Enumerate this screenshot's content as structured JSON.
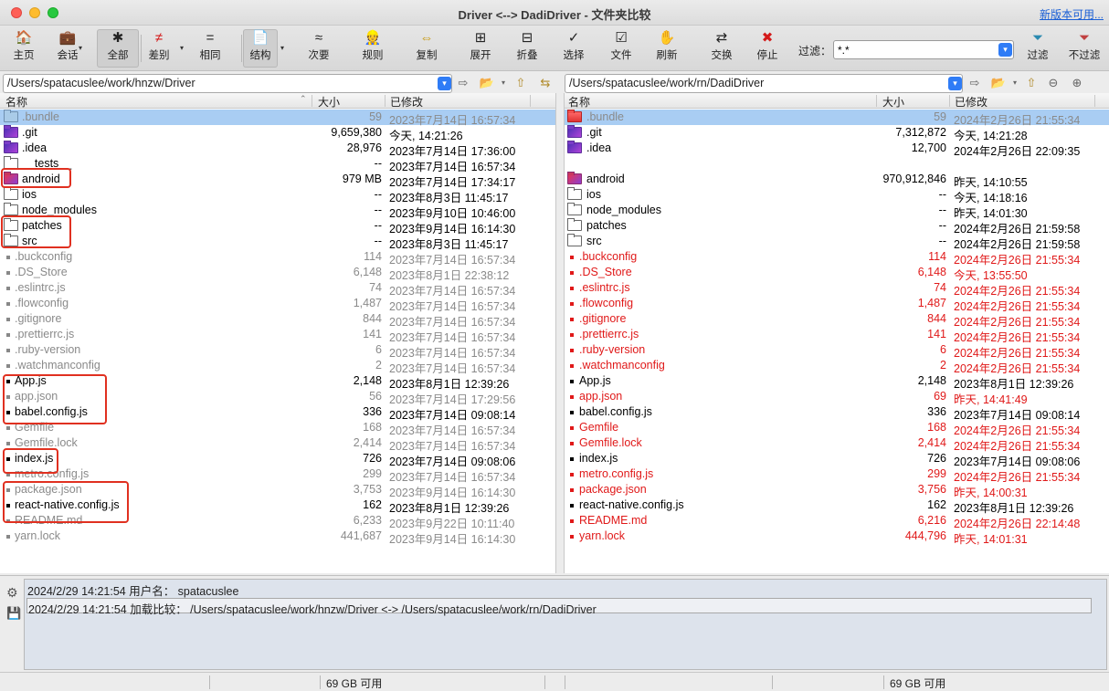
{
  "window": {
    "title": "Driver <--> DadiDriver - 文件夹比较",
    "new_version_link": "新版本可用..."
  },
  "toolbar": [
    {
      "name": "home",
      "label": "主页",
      "icon": "🏠"
    },
    {
      "name": "session",
      "label": "会话",
      "icon": "💼"
    },
    {
      "name": "all",
      "label": "全部",
      "icon": "✱"
    },
    {
      "name": "diff",
      "label": "差别",
      "icon": "≠"
    },
    {
      "name": "same",
      "label": "相同",
      "icon": "="
    },
    {
      "name": "structure",
      "label": "结构",
      "icon": "📄"
    },
    {
      "name": "minor",
      "label": "次要",
      "icon": "≈"
    },
    {
      "name": "rules",
      "label": "规则",
      "icon": "👷"
    },
    {
      "name": "copy",
      "label": "复制",
      "icon": "⇔"
    },
    {
      "name": "expand",
      "label": "展开",
      "icon": "⊞"
    },
    {
      "name": "collapse",
      "label": "折叠",
      "icon": "⊟"
    },
    {
      "name": "select",
      "label": "选择",
      "icon": "✓"
    },
    {
      "name": "files",
      "label": "文件",
      "icon": "☑"
    },
    {
      "name": "refresh",
      "label": "刷新",
      "icon": "✋"
    },
    {
      "name": "swap",
      "label": "交换",
      "icon": "⇄"
    },
    {
      "name": "stop",
      "label": "停止",
      "icon": "✖"
    },
    {
      "name": "filters",
      "label": "过滤",
      "icon": "⏷"
    },
    {
      "name": "nofilter",
      "label": "不过滤",
      "icon": "⏷"
    }
  ],
  "filter": {
    "label": "过滤：",
    "value": "*.*"
  },
  "left": {
    "path": "/Users/spatacuslee/work/hnzw/Driver",
    "headers": {
      "name": "名称",
      "size": "大小",
      "modified": "已修改"
    },
    "rows": [
      {
        "type": "folder",
        "style": "blue",
        "name": ".bundle",
        "size": "59",
        "date": "2023年7月14日 16:57:34",
        "color": "gray",
        "sel": true
      },
      {
        "type": "folder",
        "style": "pur",
        "name": ".git",
        "size": "9,659,380",
        "date": "今天, 14:21:26",
        "color": "black"
      },
      {
        "type": "folder",
        "style": "pur",
        "name": ".idea",
        "size": "28,976",
        "date": "2023年7月14日 17:36:00",
        "color": "black"
      },
      {
        "type": "folder",
        "style": "plain",
        "name": "__tests__",
        "size": "--",
        "date": "2023年7月14日 16:57:34",
        "color": "black"
      },
      {
        "type": "folder",
        "style": "redpur",
        "name": "android",
        "size": "979 MB",
        "date": "2023年7月14日 17:34:17",
        "color": "black"
      },
      {
        "type": "folder",
        "style": "plain",
        "name": "ios",
        "size": "--",
        "date": "2023年8月3日 11:45:17",
        "color": "black"
      },
      {
        "type": "folder",
        "style": "plain",
        "name": "node_modules",
        "size": "--",
        "date": "2023年9月10日 10:46:00",
        "color": "black"
      },
      {
        "type": "folder",
        "style": "plain",
        "name": "patches",
        "size": "--",
        "date": "2023年9月14日 16:14:30",
        "color": "black"
      },
      {
        "type": "folder",
        "style": "plain",
        "name": "src",
        "size": "--",
        "date": "2023年8月3日 11:45:17",
        "color": "black"
      },
      {
        "type": "file",
        "name": ".buckconfig",
        "size": "114",
        "date": "2023年7月14日 16:57:34",
        "color": "gray"
      },
      {
        "type": "file",
        "name": ".DS_Store",
        "size": "6,148",
        "date": "2023年8月1日 22:38:12",
        "color": "gray"
      },
      {
        "type": "file",
        "name": ".eslintrc.js",
        "size": "74",
        "date": "2023年7月14日 16:57:34",
        "color": "gray"
      },
      {
        "type": "file",
        "name": ".flowconfig",
        "size": "1,487",
        "date": "2023年7月14日 16:57:34",
        "color": "gray"
      },
      {
        "type": "file",
        "name": ".gitignore",
        "size": "844",
        "date": "2023年7月14日 16:57:34",
        "color": "gray"
      },
      {
        "type": "file",
        "name": ".prettierrc.js",
        "size": "141",
        "date": "2023年7月14日 16:57:34",
        "color": "gray"
      },
      {
        "type": "file",
        "name": ".ruby-version",
        "size": "6",
        "date": "2023年7月14日 16:57:34",
        "color": "gray"
      },
      {
        "type": "file",
        "name": ".watchmanconfig",
        "size": "2",
        "date": "2023年7月14日 16:57:34",
        "color": "gray"
      },
      {
        "type": "file",
        "name": "App.js",
        "size": "2,148",
        "date": "2023年8月1日 12:39:26",
        "color": "black"
      },
      {
        "type": "file",
        "name": "app.json",
        "size": "56",
        "date": "2023年7月14日 17:29:56",
        "color": "gray"
      },
      {
        "type": "file",
        "name": "babel.config.js",
        "size": "336",
        "date": "2023年7月14日 09:08:14",
        "color": "black"
      },
      {
        "type": "file",
        "name": "Gemfile",
        "size": "168",
        "date": "2023年7月14日 16:57:34",
        "color": "gray"
      },
      {
        "type": "file",
        "name": "Gemfile.lock",
        "size": "2,414",
        "date": "2023年7月14日 16:57:34",
        "color": "gray"
      },
      {
        "type": "file",
        "name": "index.js",
        "size": "726",
        "date": "2023年7月14日 09:08:06",
        "color": "black"
      },
      {
        "type": "file",
        "name": "metro.config.js",
        "size": "299",
        "date": "2023年7月14日 16:57:34",
        "color": "gray"
      },
      {
        "type": "file",
        "name": "package.json",
        "size": "3,753",
        "date": "2023年9月14日 16:14:30",
        "color": "gray"
      },
      {
        "type": "file",
        "name": "react-native.config.js",
        "size": "162",
        "date": "2023年8月1日 12:39:26",
        "color": "black"
      },
      {
        "type": "file",
        "name": "README.md",
        "size": "6,233",
        "date": "2023年9月22日 10:11:40",
        "color": "gray"
      },
      {
        "type": "file",
        "name": "yarn.lock",
        "size": "441,687",
        "date": "2023年9月14日 16:14:30",
        "color": "gray"
      }
    ]
  },
  "right": {
    "path": "/Users/spatacuslee/work/rn/DadiDriver",
    "headers": {
      "name": "名称",
      "size": "大小",
      "modified": "已修改"
    },
    "rows": [
      {
        "type": "folder",
        "style": "red",
        "name": ".bundle",
        "size": "59",
        "date": "2024年2月26日 21:55:34",
        "color": "gray",
        "sel": true
      },
      {
        "type": "folder",
        "style": "pur",
        "name": ".git",
        "size": "7,312,872",
        "date": "今天, 14:21:28",
        "color": "black"
      },
      {
        "type": "folder",
        "style": "pur",
        "name": ".idea",
        "size": "12,700",
        "date": "2024年2月26日 22:09:35",
        "color": "black"
      },
      {
        "type": "empty"
      },
      {
        "type": "folder",
        "style": "redpur",
        "name": "android",
        "size": "970,912,846",
        "date": "昨天, 14:10:55",
        "color": "black"
      },
      {
        "type": "folder",
        "style": "plain",
        "name": "ios",
        "size": "--",
        "date": "今天, 14:18:16",
        "color": "black"
      },
      {
        "type": "folder",
        "style": "plain",
        "name": "node_modules",
        "size": "--",
        "date": "昨天, 14:01:30",
        "color": "black"
      },
      {
        "type": "folder",
        "style": "plain",
        "name": "patches",
        "size": "--",
        "date": "2024年2月26日 21:59:58",
        "color": "black"
      },
      {
        "type": "folder",
        "style": "plain",
        "name": "src",
        "size": "--",
        "date": "2024年2月26日 21:59:58",
        "color": "black"
      },
      {
        "type": "file",
        "name": ".buckconfig",
        "size": "114",
        "date": "2024年2月26日 21:55:34",
        "color": "red"
      },
      {
        "type": "file",
        "name": ".DS_Store",
        "size": "6,148",
        "date": "今天, 13:55:50",
        "color": "red"
      },
      {
        "type": "file",
        "name": ".eslintrc.js",
        "size": "74",
        "date": "2024年2月26日 21:55:34",
        "color": "red"
      },
      {
        "type": "file",
        "name": ".flowconfig",
        "size": "1,487",
        "date": "2024年2月26日 21:55:34",
        "color": "red"
      },
      {
        "type": "file",
        "name": ".gitignore",
        "size": "844",
        "date": "2024年2月26日 21:55:34",
        "color": "red"
      },
      {
        "type": "file",
        "name": ".prettierrc.js",
        "size": "141",
        "date": "2024年2月26日 21:55:34",
        "color": "red"
      },
      {
        "type": "file",
        "name": ".ruby-version",
        "size": "6",
        "date": "2024年2月26日 21:55:34",
        "color": "red"
      },
      {
        "type": "file",
        "name": ".watchmanconfig",
        "size": "2",
        "date": "2024年2月26日 21:55:34",
        "color": "red"
      },
      {
        "type": "file",
        "name": "App.js",
        "size": "2,148",
        "date": "2023年8月1日 12:39:26",
        "color": "black"
      },
      {
        "type": "file",
        "name": "app.json",
        "size": "69",
        "date": "昨天, 14:41:49",
        "color": "red"
      },
      {
        "type": "file",
        "name": "babel.config.js",
        "size": "336",
        "date": "2023年7月14日 09:08:14",
        "color": "black"
      },
      {
        "type": "file",
        "name": "Gemfile",
        "size": "168",
        "date": "2024年2月26日 21:55:34",
        "color": "red"
      },
      {
        "type": "file",
        "name": "Gemfile.lock",
        "size": "2,414",
        "date": "2024年2月26日 21:55:34",
        "color": "red"
      },
      {
        "type": "file",
        "name": "index.js",
        "size": "726",
        "date": "2023年7月14日 09:08:06",
        "color": "black"
      },
      {
        "type": "file",
        "name": "metro.config.js",
        "size": "299",
        "date": "2024年2月26日 21:55:34",
        "color": "red"
      },
      {
        "type": "file",
        "name": "package.json",
        "size": "3,756",
        "date": "昨天, 14:00:31",
        "color": "red"
      },
      {
        "type": "file",
        "name": "react-native.config.js",
        "size": "162",
        "date": "2023年8月1日 12:39:26",
        "color": "black"
      },
      {
        "type": "file",
        "name": "README.md",
        "size": "6,216",
        "date": "2024年2月26日 22:14:48",
        "color": "red"
      },
      {
        "type": "file",
        "name": "yarn.lock",
        "size": "444,796",
        "date": "昨天, 14:01:31",
        "color": "red"
      }
    ]
  },
  "log": [
    "2024/2/29 14:21:54  用户名：  spatacuslee",
    "2024/2/29 14:21:54  加载比较：  /Users/spatacuslee/work/hnzw/Driver <-> /Users/spatacuslee/work/rn/DadiDriver"
  ],
  "status": {
    "left_free": "69 GB 可用",
    "right_free": "69 GB 可用"
  },
  "colors": {
    "diff": "#e01919",
    "orphan_gray": "#8a8a8a",
    "selection": "#a9cdf3",
    "annotation": "#e03020"
  }
}
